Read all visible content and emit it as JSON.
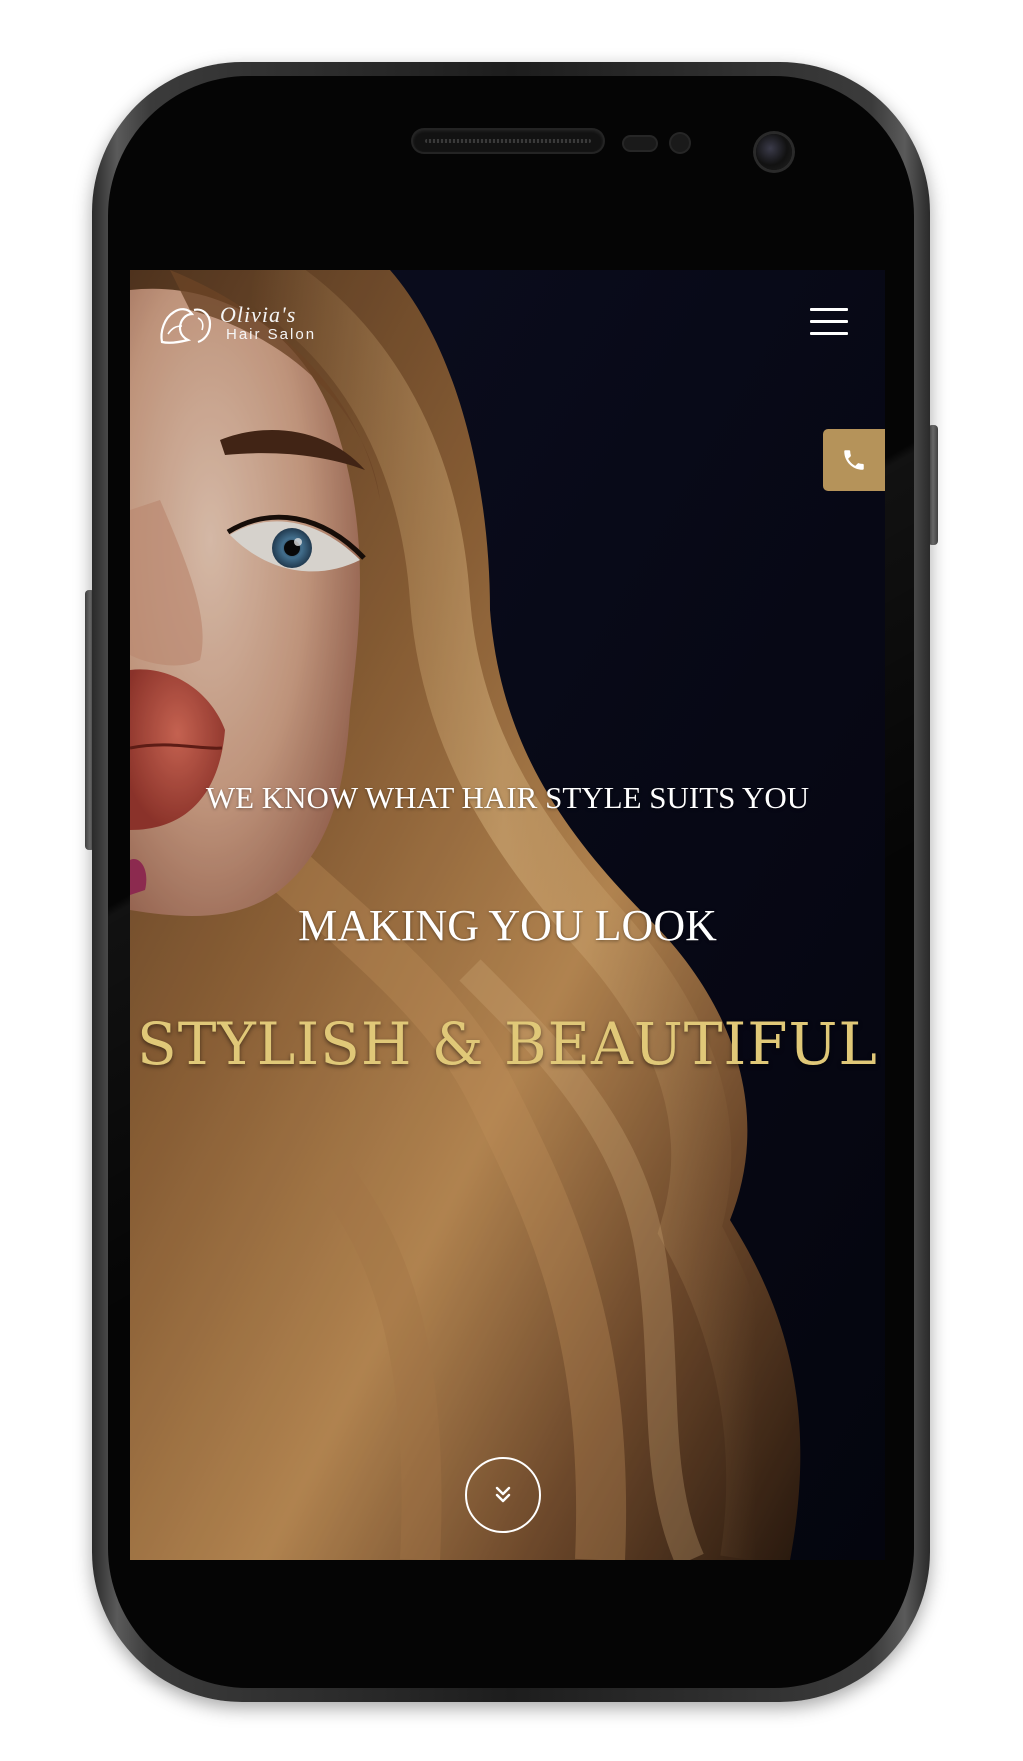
{
  "site": {
    "logo_script": "Olivia's",
    "logo_subtitle": "Hair Salon",
    "logo_icon": "woman-silhouette-icon"
  },
  "header": {
    "menu_icon": "hamburger-menu-icon"
  },
  "call_button": {
    "icon": "phone-icon",
    "color": "#b5935a"
  },
  "hero": {
    "line1": "WE KNOW WHAT HAIR STYLE SUITS YOU",
    "line2": "MAKING YOU LOOK",
    "line3": "STYLISH & BEAUTIFUL",
    "line3_color": "#e0c878",
    "scroll_icon": "double-chevron-down-icon"
  }
}
